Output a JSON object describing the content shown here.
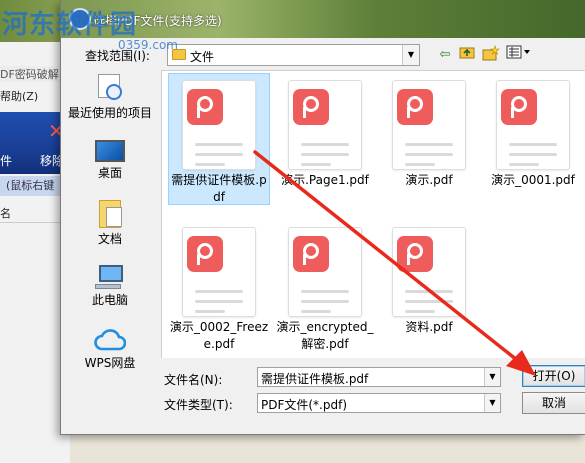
{
  "background_app": {
    "title_fragment": "DF密码破解",
    "menu_help": "帮助(Z)",
    "toolbar_label_a": "件",
    "toolbar_label_b": "移除",
    "status_hint": "(鼠标右键",
    "column_header": "名"
  },
  "watermark": {
    "text": "河东软件园",
    "url": "0359.com"
  },
  "dialog": {
    "title": "选择PDF文件(支持多选)",
    "look_in_label": "查找范围(I):",
    "look_in_value": "文件",
    "nav_icons": [
      "back-arrow-icon",
      "up-folder-icon",
      "new-folder-icon",
      "view-menu-icon"
    ]
  },
  "places": [
    {
      "label": "最近使用的项目",
      "icon": "recent-items-icon"
    },
    {
      "label": "桌面",
      "icon": "desktop-icon"
    },
    {
      "label": "文档",
      "icon": "documents-icon"
    },
    {
      "label": "此电脑",
      "icon": "computer-icon"
    },
    {
      "label": "WPS网盘",
      "icon": "cloud-icon"
    }
  ],
  "files": [
    {
      "name": "需提供证件模板.pdf",
      "selected": true
    },
    {
      "name": "演示.Page1.pdf",
      "selected": false
    },
    {
      "name": "演示.pdf",
      "selected": false
    },
    {
      "name": "演示_0001.pdf",
      "selected": false
    },
    {
      "name": "演示_0002_Freeze.pdf",
      "selected": false
    },
    {
      "name": "演示_encrypted_解密.pdf",
      "selected": false
    },
    {
      "name": "资料.pdf",
      "selected": false
    }
  ],
  "filename_field": {
    "label": "文件名(N):",
    "value": "需提供证件模板.pdf"
  },
  "filetype_field": {
    "label": "文件类型(T):",
    "value": "PDF文件(*.pdf)"
  },
  "buttons": {
    "open": "打开(O)",
    "cancel": "取消"
  },
  "colors": {
    "pdf_badge": "#ee5c5c",
    "selection": "#cce8ff",
    "annotation_arrow": "#e8291c"
  }
}
